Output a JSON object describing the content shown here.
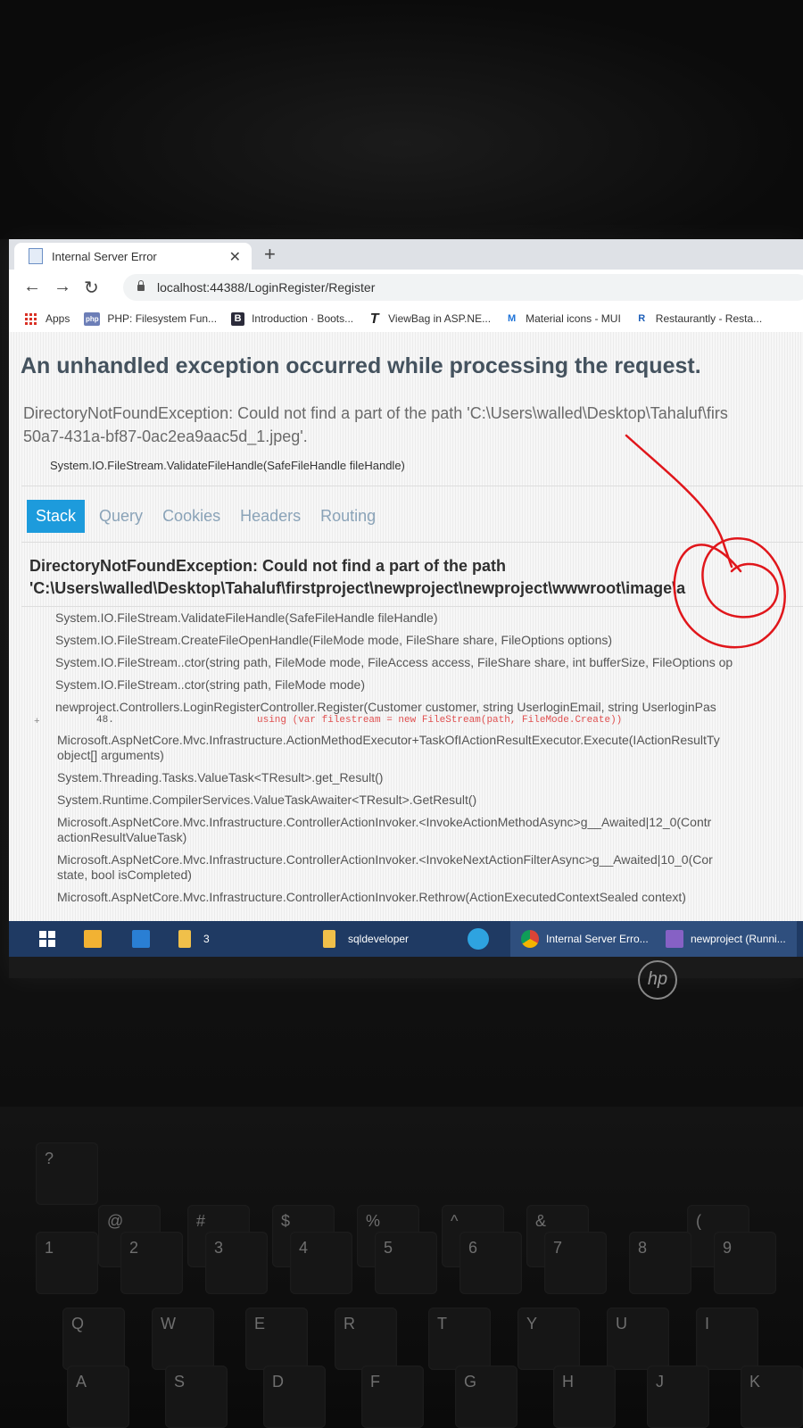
{
  "browser": {
    "tab_title": "Internal Server Error",
    "tab_close": "✕",
    "new_tab": "+",
    "url": "localhost:44388/LoginRegister/Register",
    "bookmarks": [
      {
        "label": "Apps",
        "icon": "apps-grid-icon"
      },
      {
        "label": "PHP: Filesystem Fun...",
        "icon": "php-icon",
        "badge": "php"
      },
      {
        "label": "Introduction · Boots...",
        "icon": "bootstrap-icon",
        "badge": "B"
      },
      {
        "label": "ViewBag in ASP.NE...",
        "icon": "t-icon",
        "badge": "T"
      },
      {
        "label": "Material icons - MUI",
        "icon": "mui-icon",
        "badge": "M"
      },
      {
        "label": "Restaurantly - Resta...",
        "icon": "restaurantly-icon",
        "badge": "R"
      }
    ]
  },
  "page": {
    "heading": "An unhandled exception occurred while processing the request.",
    "message_line1": "DirectoryNotFoundException: Could not find a part of the path 'C:\\Users\\walled\\Desktop\\Tahaluf\\firs",
    "message_line2": "50a7-431a-bf87-0ac2ea9aac5d_1.jpeg'.",
    "location": "System.IO.FileStream.ValidateFileHandle(SafeFileHandle fileHandle)",
    "tabs": [
      "Stack",
      "Query",
      "Cookies",
      "Headers",
      "Routing"
    ],
    "active_tab": "Stack",
    "exception_title_line1": "DirectoryNotFoundException: Could not find a part of the path",
    "exception_title_line2": "'C:\\Users\\walled\\Desktop\\Tahaluf\\firstproject\\newproject\\newproject\\wwwroot\\image\\a",
    "frames": [
      "System.IO.FileStream.ValidateFileHandle(SafeFileHandle fileHandle)",
      "System.IO.FileStream.CreateFileOpenHandle(FileMode mode, FileShare share, FileOptions options)",
      "System.IO.FileStream..ctor(string path, FileMode mode, FileAccess access, FileShare share, int bufferSize, FileOptions op",
      "System.IO.FileStream..ctor(string path, FileMode mode)",
      "newproject.Controllers.LoginRegisterController.Register(Customer customer, string UserloginEmail, string UserloginPas"
    ],
    "code": {
      "expand": "+",
      "line_number": "48.",
      "source": "using (var filestream = new FileStream(path, FileMode.Create))"
    },
    "frames_after": [
      "Microsoft.AspNetCore.Mvc.Infrastructure.ActionMethodExecutor+TaskOfIActionResultExecutor.Execute(IActionResultTy",
      "object[] arguments)",
      "System.Threading.Tasks.ValueTask<TResult>.get_Result()",
      "System.Runtime.CompilerServices.ValueTaskAwaiter<TResult>.GetResult()",
      "Microsoft.AspNetCore.Mvc.Infrastructure.ControllerActionInvoker.<InvokeActionMethodAsync>g__Awaited|12_0(Contr",
      "actionResultValueTask)",
      "Microsoft.AspNetCore.Mvc.Infrastructure.ControllerActionInvoker.<InvokeNextActionFilterAsync>g__Awaited|10_0(Cor",
      "state, bool isCompleted)",
      "Microsoft.AspNetCore.Mvc.Infrastructure.ControllerActionInvoker.Rethrow(ActionExecutedContextSealed context)"
    ]
  },
  "taskbar": {
    "explorer_badge": "3",
    "items": [
      "sqldeveloper",
      "Internal Server Erro...",
      "newproject (Runni..."
    ]
  },
  "laptop": {
    "logo": "hp",
    "keys": [
      "?",
      "@",
      "#",
      "$",
      "%",
      "^",
      "&",
      "(",
      "1",
      "2",
      "3",
      "4",
      "5",
      "6",
      "7",
      "8",
      "9",
      "Q",
      "W",
      "E",
      "R",
      "T",
      "Y",
      "U",
      "I",
      "A",
      "S",
      "D",
      "F",
      "G",
      "H",
      "J",
      "K"
    ]
  },
  "colors": {
    "accent": "#1d9bdc",
    "annotation": "#e0161b",
    "taskbar": "#1f3a63"
  }
}
